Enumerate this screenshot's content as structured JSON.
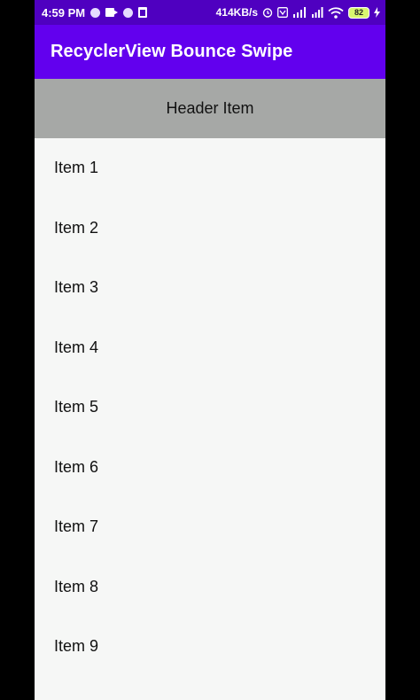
{
  "status_bar": {
    "time": "4:59 PM",
    "speed": "414KB/s",
    "battery": "82"
  },
  "app_bar": {
    "title": "RecyclerView Bounce Swipe"
  },
  "list": {
    "header": "Header Item",
    "items": [
      "Item 1",
      "Item 2",
      "Item 3",
      "Item 4",
      "Item 5",
      "Item 6",
      "Item 7",
      "Item 8",
      "Item 9"
    ]
  },
  "colors": {
    "status_bar": "#4f00c0",
    "app_bar": "#6200ee",
    "header_bg": "#a6a8a6",
    "list_bg": "#f6f7f6"
  }
}
